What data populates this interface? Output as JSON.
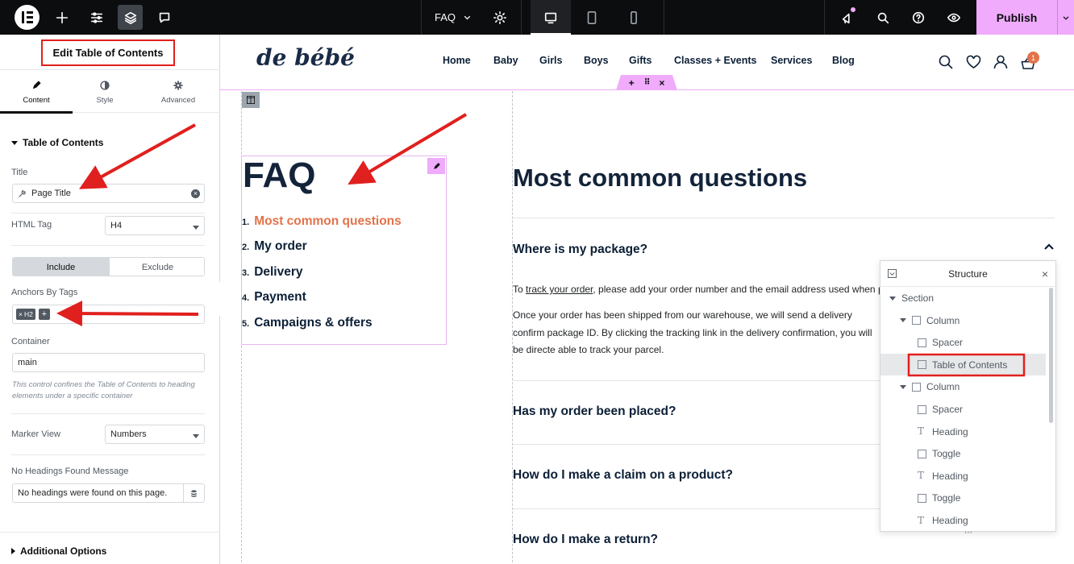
{
  "topbar": {
    "page_name": "FAQ",
    "publish_label": "Publish",
    "icons": [
      "elementor-logo-icon",
      "add-icon",
      "site-settings-icon",
      "structure-layers-icon",
      "notes-icon",
      "gear-icon",
      "desktop-icon",
      "tablet-icon",
      "mobile-icon",
      "whats-new-icon",
      "search-icon",
      "help-icon",
      "preview-eye-icon",
      "chevron-down-icon"
    ]
  },
  "panel": {
    "title": "Edit Table of Contents",
    "tabs": [
      {
        "label": "Content"
      },
      {
        "label": "Style"
      },
      {
        "label": "Advanced"
      }
    ],
    "section_title": "Table of Contents",
    "title_label": "Title",
    "title_value": "Page Title",
    "html_tag_label": "HTML Tag",
    "html_tag_value": "H4",
    "include_label": "Include",
    "exclude_label": "Exclude",
    "anchors_label": "Anchors By Tags",
    "anchors_tag": "H2",
    "container_label": "Container",
    "container_value": "main",
    "container_note": "This control confines the Table of Contents to heading elements under a specific container",
    "marker_label": "Marker View",
    "marker_value": "Numbers",
    "no_headings_label": "No Headings Found Message",
    "no_headings_value": "No headings were found on this page.",
    "additional_label": "Additional Options"
  },
  "site": {
    "logo": "de bébé",
    "nav": [
      "Home",
      "Baby",
      "Girls",
      "Boys",
      "Gifts",
      "Classes + Events",
      "Services",
      "Blog"
    ],
    "cart_count": "1"
  },
  "content": {
    "faq_title": "FAQ",
    "toc": [
      {
        "num": "1.",
        "text": "Most common questions",
        "color": "#e2734a"
      },
      {
        "num": "2.",
        "text": "My order"
      },
      {
        "num": "3.",
        "text": "Delivery"
      },
      {
        "num": "4.",
        "text": "Payment"
      },
      {
        "num": "5.",
        "text": "Campaigns & offers"
      }
    ],
    "main_title": "Most common questions",
    "questions": [
      "Where is my package?",
      "Has my order been placed?",
      "How do I make a claim on a product?",
      "How do I make a return?"
    ],
    "answer_p1_pre": "To ",
    "answer_p1_link": "track your order",
    "answer_p1_post": ", please add your order number and the email address used when p",
    "answer_p2": "Once your order has been shipped from our warehouse, we will send a delivery confirm package ID. By clicking the tracking link in the delivery confirmation, you will be directe able to track your parcel."
  },
  "structure": {
    "title": "Structure",
    "items": [
      {
        "label": "Section",
        "level": 0
      },
      {
        "label": "Column",
        "level": 1
      },
      {
        "label": "Spacer",
        "level": 2
      },
      {
        "label": "Table of Contents",
        "level": 2
      },
      {
        "label": "Column",
        "level": 1
      },
      {
        "label": "Spacer",
        "level": 2
      },
      {
        "label": "Heading",
        "level": 2
      },
      {
        "label": "Toggle",
        "level": 2
      },
      {
        "label": "Heading",
        "level": 2
      },
      {
        "label": "Toggle",
        "level": 2
      },
      {
        "label": "Heading",
        "level": 2
      }
    ]
  },
  "colors": {
    "accent": "#f0abfc",
    "annotation": "#e0201e",
    "toc_active": "#e2734a"
  }
}
